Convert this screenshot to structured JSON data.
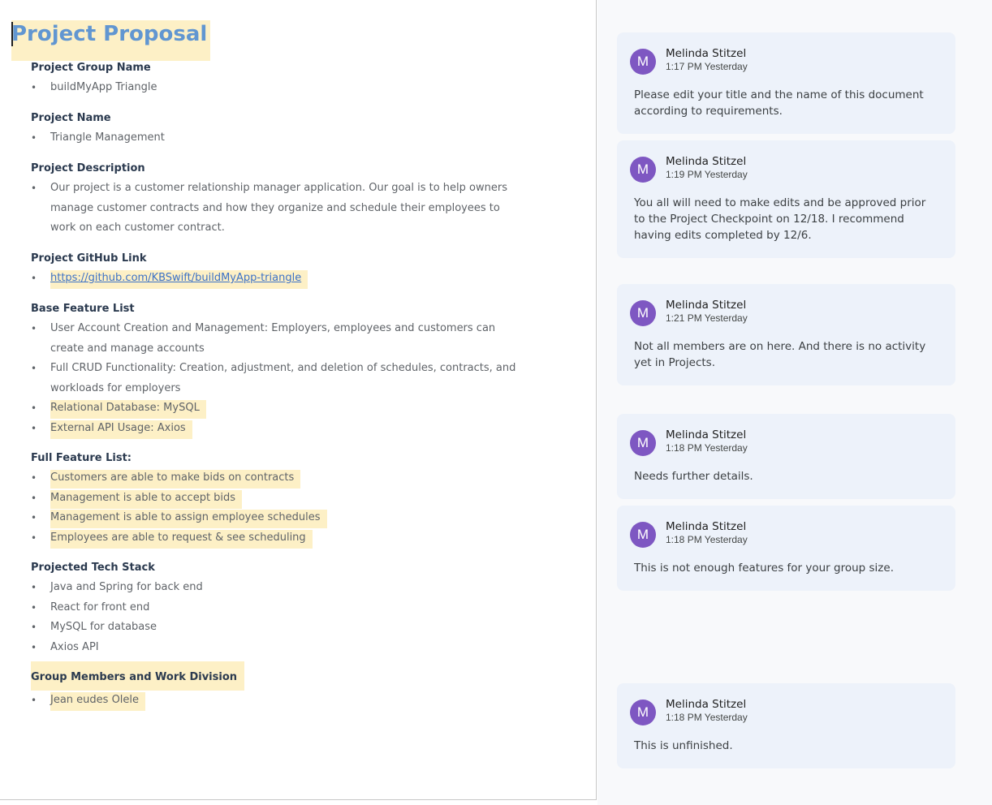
{
  "document": {
    "title": "Project Proposal",
    "sections": [
      {
        "heading": "Project Group Name",
        "items": [
          "buildMyApp Triangle"
        ]
      },
      {
        "heading": "Project Name",
        "items": [
          "Triangle Management"
        ]
      },
      {
        "heading": "Project Description",
        "items": [
          "Our project is a customer relationship manager application. Our goal is to help owners manage customer contracts and how they organize and schedule their employees to work on each customer contract."
        ]
      },
      {
        "heading": "Project GitHub Link",
        "items": [
          "https://github.com/KBSwift/buildMyApp-triangle"
        ]
      },
      {
        "heading": "Base Feature List",
        "items": [
          "User Account Creation and Management: Employers, employees and customers can create and manage accounts",
          "Full CRUD Functionality: Creation, adjustment, and deletion of schedules, contracts, and workloads for employers",
          "Relational Database: MySQL",
          "External API Usage: Axios"
        ]
      },
      {
        "heading": "Full Feature List:",
        "items": [
          "Customers are able to make bids on contracts",
          "Management is able to accept bids",
          "Management is able to assign employee schedules",
          "Employees are able to request & see scheduling"
        ]
      },
      {
        "heading": "Projected Tech Stack",
        "items": [
          "Java and Spring for back end",
          "React for front end",
          "MySQL for database",
          "Axios API"
        ]
      },
      {
        "heading": "Group Members and Work Division",
        "items": [
          "Jean eudes Olele"
        ]
      }
    ]
  },
  "comments": [
    {
      "avatar": "M",
      "author": "Melinda Stitzel",
      "time": "1:17 PM Yesterday",
      "text": "Please edit your title and the name of this document according to requirements."
    },
    {
      "avatar": "M",
      "author": "Melinda Stitzel",
      "time": "1:19 PM Yesterday",
      "text": "You all will need to make edits and be approved prior to the Project Checkpoint on 12/18. I recommend having edits completed by 12/6."
    },
    {
      "avatar": "M",
      "author": "Melinda Stitzel",
      "time": "1:21 PM Yesterday",
      "text": "Not all members are on here. And there is no activity yet in Projects."
    },
    {
      "avatar": "M",
      "author": "Melinda Stitzel",
      "time": "1:18 PM Yesterday",
      "text": "Needs further details."
    },
    {
      "avatar": "M",
      "author": "Melinda Stitzel",
      "time": "1:18 PM Yesterday",
      "text": "This is not enough features for your group size."
    },
    {
      "avatar": "M",
      "author": "Melinda Stitzel",
      "time": "1:18 PM Yesterday",
      "text": "This is unfinished."
    }
  ],
  "colors": {
    "highlight": "#fdf0c6",
    "title": "#6196d1",
    "link": "#3d72c6",
    "avatar": "#7e57c2",
    "comment_card": "#edf2fa"
  }
}
